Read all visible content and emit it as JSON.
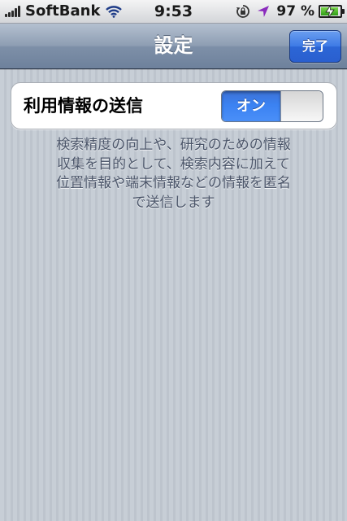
{
  "status_bar": {
    "carrier": "SoftBank",
    "time": "9:53",
    "battery_percent": "97 %",
    "battery_level": 0.97,
    "icons": [
      "signal-icon",
      "wifi-icon",
      "rotation-lock-icon",
      "location-icon",
      "battery-charging-icon"
    ]
  },
  "nav": {
    "title": "設定",
    "done_label": "完了"
  },
  "settings": {
    "row_label": "利用情報の送信",
    "toggle_label": "オン",
    "toggle_state": true
  },
  "footer": {
    "lines": [
      "検索精度の向上や、研究のための情報",
      "収集を目的として、検索内容に加えて",
      "位置情報や端末情報などの情報を匿名",
      "で送信します"
    ]
  },
  "colors": {
    "accent_blue": "#3b82f2",
    "nav_bar": "#8d9db2",
    "background": "#c5ccd4"
  }
}
